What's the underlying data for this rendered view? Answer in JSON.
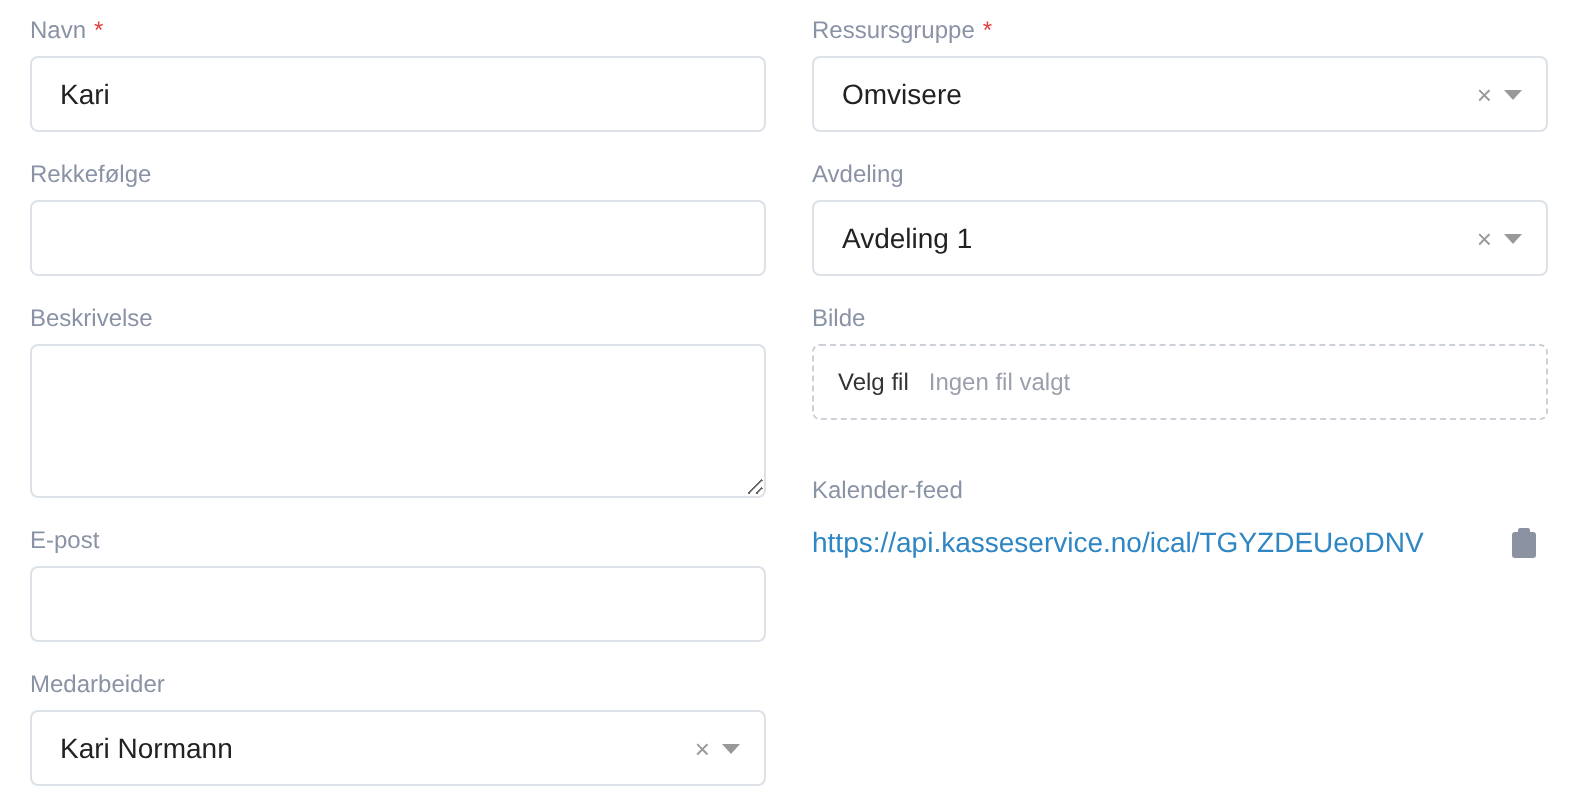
{
  "left_fields": [
    {
      "kind": "text",
      "label": "Navn",
      "required_mark": "*",
      "value": "Kari"
    },
    {
      "kind": "text",
      "label": "Rekkefølge"
    },
    {
      "kind": "textarea",
      "label": "Beskrivelse"
    },
    {
      "kind": "text",
      "label": "E-post"
    },
    {
      "kind": "select",
      "label": "Medarbeider",
      "value": "Kari Normann",
      "clear": "×"
    }
  ],
  "right_fields": [
    {
      "kind": "select",
      "label": "Ressursgruppe",
      "required_mark": "*",
      "value": "Omvisere",
      "clear": "×"
    },
    {
      "kind": "select",
      "label": "Avdeling",
      "value": "Avdeling 1",
      "clear": "×"
    },
    {
      "kind": "file",
      "label": "Bilde",
      "button": "Velg fil",
      "status": "Ingen fil valgt"
    },
    {
      "kind": "feed",
      "label": "Kalender-feed",
      "link": "https://api.kasseservice.no/ical/TGYZDEUeoDNV"
    }
  ]
}
